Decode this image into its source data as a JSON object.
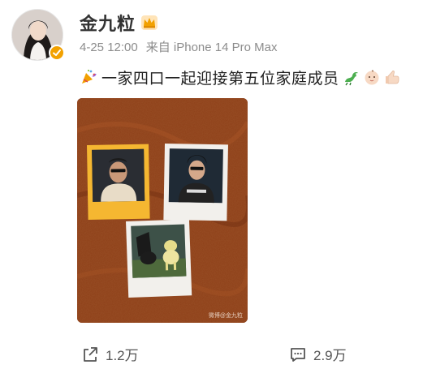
{
  "user": {
    "name": "金九粒",
    "crown_icon": "crown-icon",
    "verify_icon": "verified-badge-icon"
  },
  "meta": {
    "time": "4-25 12:00",
    "source": "来自 iPhone 14 Pro Max"
  },
  "post": {
    "leading_emoji": "party-popper-icon",
    "text": "一家四口一起迎接第五位家庭成员",
    "trailing_emojis": [
      "dragon-icon",
      "baby-icon",
      "thumb-icon"
    ]
  },
  "photo": {
    "description_icon": "polaroid-photo",
    "watermark": "微博@金九粒"
  },
  "actions": {
    "share_count": "1.2万",
    "comment_count": "2.9万"
  },
  "colors": {
    "accent": "#f2a100",
    "meta_text": "#8c8c8c",
    "photo_bg": "#8f4019"
  }
}
